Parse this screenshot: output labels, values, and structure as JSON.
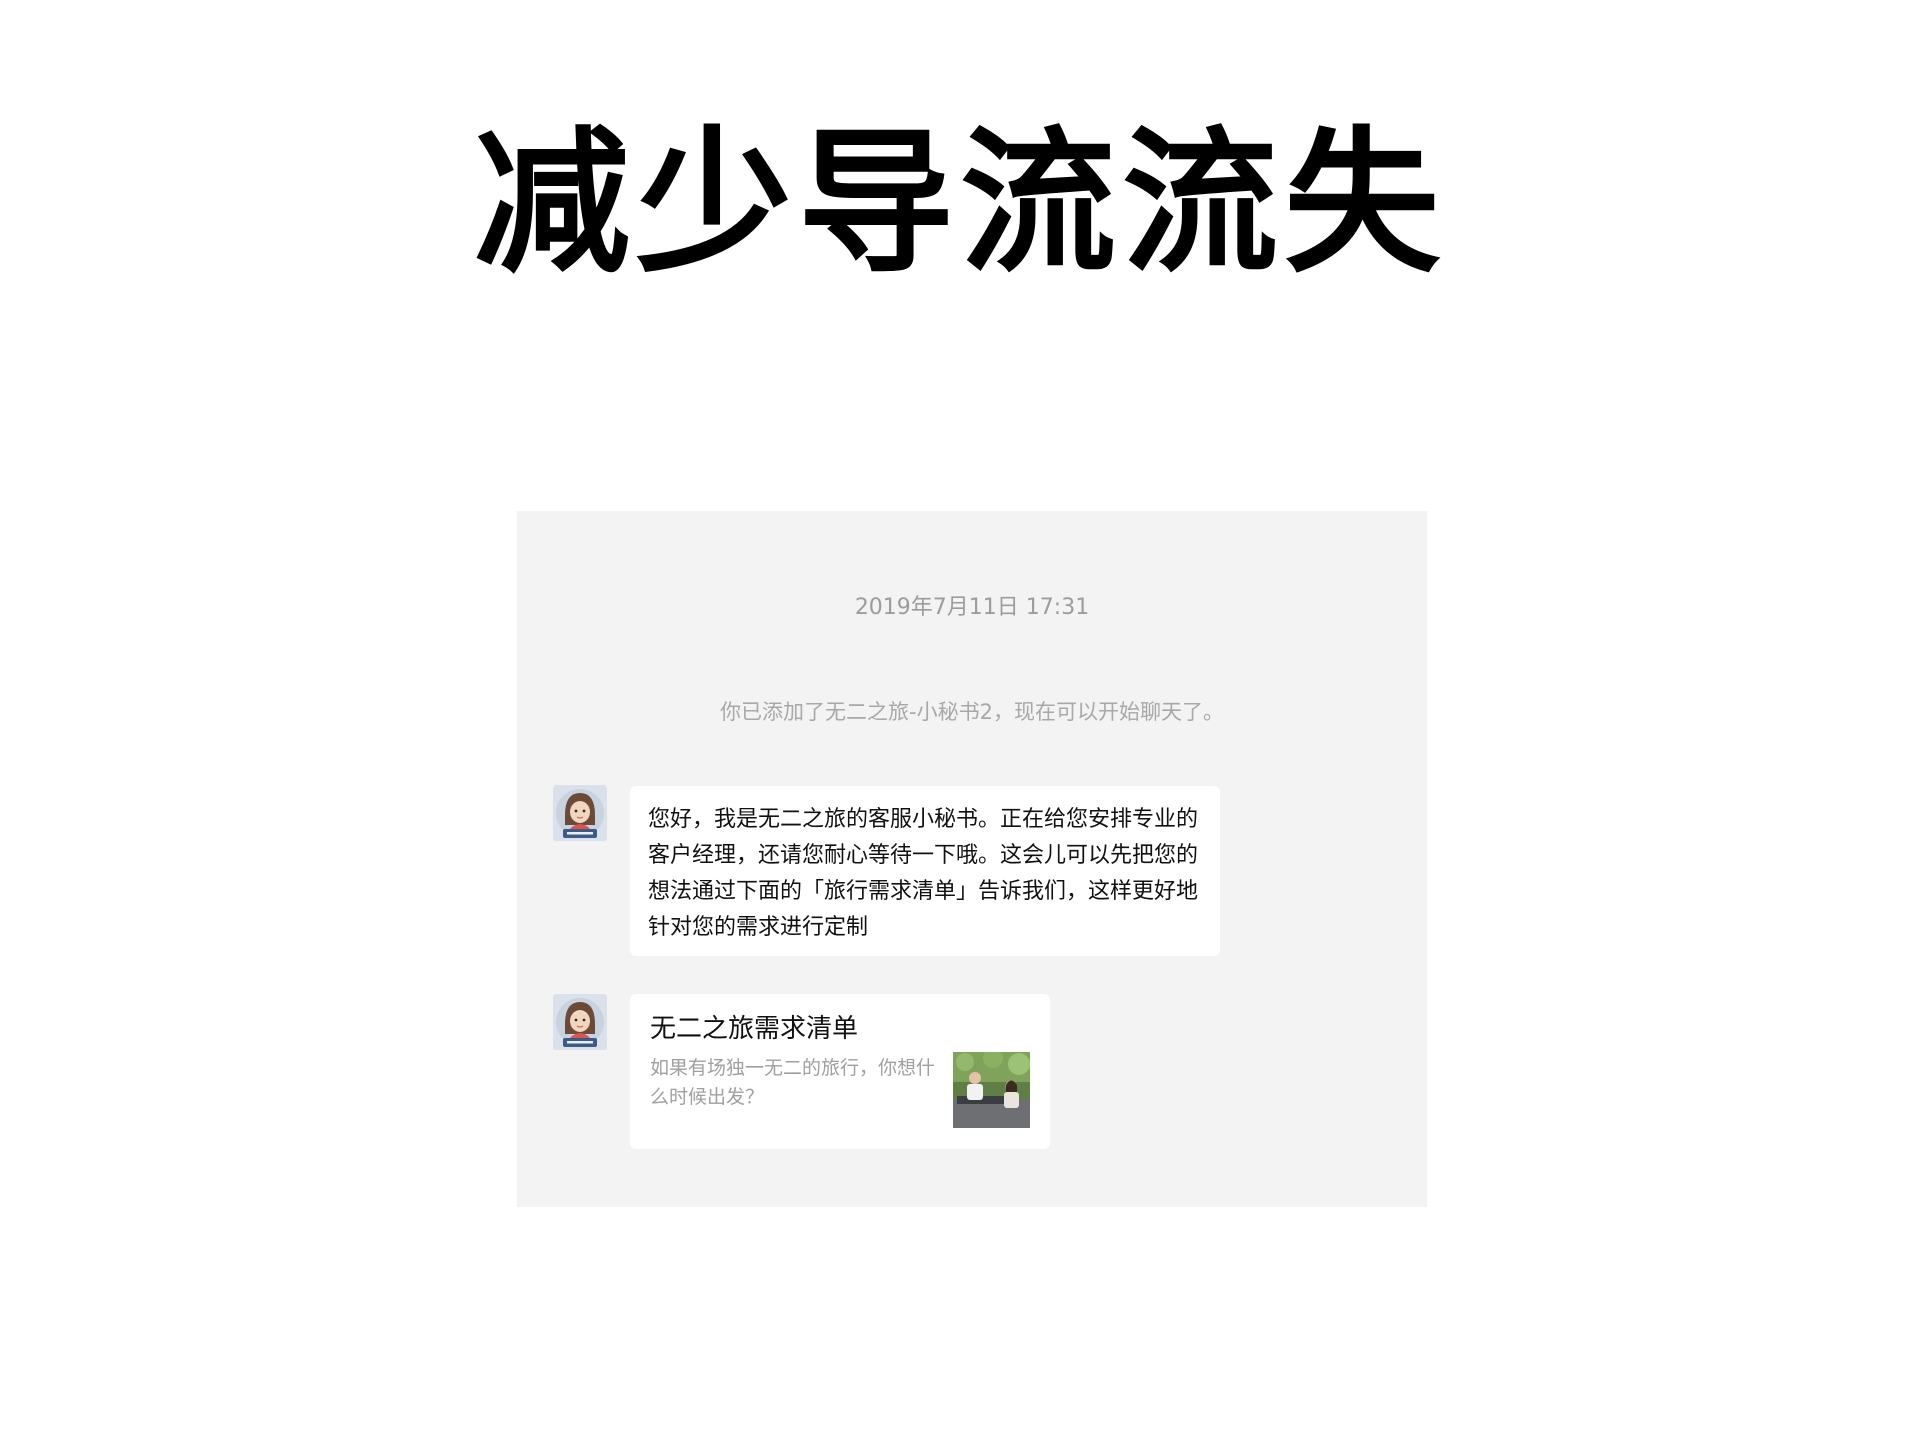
{
  "slide": {
    "title": "减少导流流失"
  },
  "chat": {
    "timestamp": "2019年7月11日 17:31",
    "system_notice": "你已添加了无二之旅-小秘书2，现在可以开始聊天了。",
    "messages": [
      {
        "type": "text",
        "avatar_icon": "avatar-icon",
        "text": "您好，我是无二之旅的客服小秘书。正在给您安排专业的客户经理，还请您耐心等待一下哦。这会儿可以先把您的想法通过下面的「旅行需求清单」告诉我们，这样更好地针对您的需求进行定制"
      },
      {
        "type": "card",
        "avatar_icon": "avatar-icon",
        "title": "无二之旅需求清单",
        "description": "如果有场独一无二的旅行，你想什么时候出发？",
        "thumbnail_icon": "photo-thumbnail-icon"
      }
    ]
  },
  "colors": {
    "page_background": "#ffffff",
    "chat_background": "#f3f3f3",
    "bubble_background": "#ffffff",
    "muted_text": "#a0a0a0"
  }
}
